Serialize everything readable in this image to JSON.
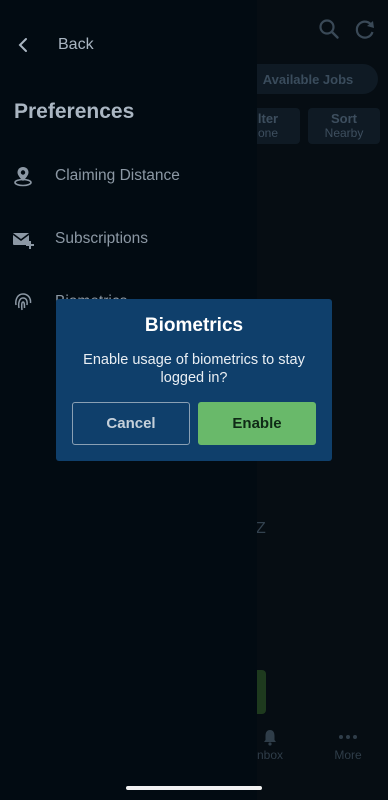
{
  "background": {
    "available_jobs_label": "Available Jobs",
    "filter_label": "lter",
    "filter_sub": "one",
    "sort_label": "Sort",
    "sort_sub": "Nearby",
    "stray_text": "Z",
    "tab_inbox_label": "nbox",
    "tab_more_label": "More",
    "top_icons": [
      "search-icon",
      "refresh-icon"
    ]
  },
  "drawer": {
    "back_label": "Back",
    "title": "Preferences",
    "items": [
      {
        "label": "Claiming Distance",
        "icon": "location-pin-icon"
      },
      {
        "label": "Subscriptions",
        "icon": "mail-plus-icon"
      },
      {
        "label": "Biometrics",
        "icon": "fingerprint-icon"
      }
    ]
  },
  "modal": {
    "title": "Biometrics",
    "message": "Enable usage of biometrics to stay logged in?",
    "cancel_label": "Cancel",
    "enable_label": "Enable"
  },
  "colors": {
    "modal_bg": "#0f3f6b",
    "enable_button": "#69b96a",
    "drawer_bg": "#020b12"
  }
}
